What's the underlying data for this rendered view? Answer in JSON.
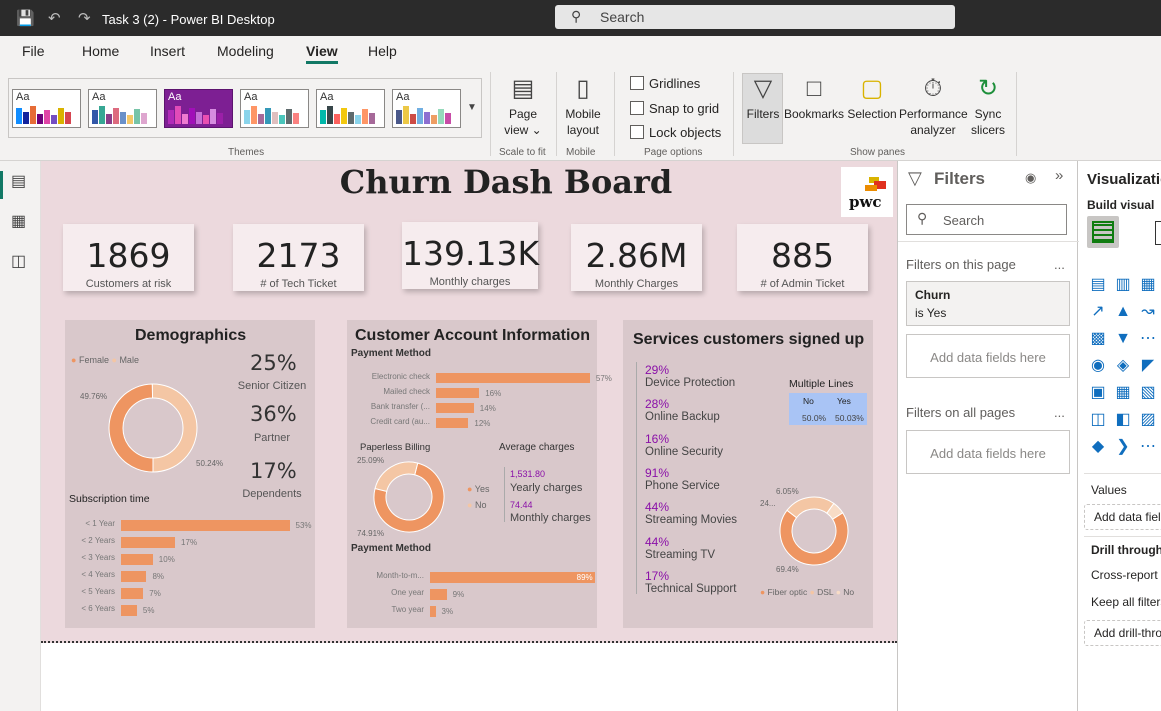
{
  "app": {
    "title": "Task 3 (2) - Power BI Desktop"
  },
  "titlebar": {
    "search_placeholder": "Search"
  },
  "menu": {
    "items": [
      "File",
      "Home",
      "Insert",
      "Modeling",
      "View",
      "Help"
    ],
    "active": "View"
  },
  "ribbon": {
    "themes_label": "Themes",
    "theme_badge": "Aa",
    "page_view": {
      "line1": "Page",
      "line2": "view",
      "group": "Scale to fit"
    },
    "mobile": {
      "line1": "Mobile",
      "line2": "layout",
      "group": "Mobile"
    },
    "page_options": {
      "gridlines": "Gridlines",
      "snap": "Snap to grid",
      "lock": "Lock objects",
      "group": "Page options"
    },
    "show_panes": {
      "filters": "Filters",
      "bookmarks": "Bookmarks",
      "selection": "Selection",
      "performance": "Performance",
      "analyzer": "analyzer",
      "sync": "Sync",
      "slicers": "slicers",
      "group": "Show panes"
    }
  },
  "report": {
    "title": "Churn Dash Board",
    "logo_text": "pwc",
    "kpis": [
      {
        "value": "1869",
        "label": "Customers at risk"
      },
      {
        "value": "2173",
        "label": "# of Tech Ticket"
      },
      {
        "value": "139.13K",
        "label": "Monthly charges"
      },
      {
        "value": "2.86M",
        "label": "Monthly Charges"
      },
      {
        "value": "885",
        "label": "# of Admin Ticket"
      }
    ],
    "demographics": {
      "title": "Demographics",
      "legend": [
        "Female",
        "Male"
      ],
      "donut_labels": [
        "49.76%",
        "50.24%"
      ],
      "stats": [
        {
          "value": "25%",
          "label": "Senior Citizen"
        },
        {
          "value": "36%",
          "label": "Partner"
        },
        {
          "value": "17%",
          "label": "Dependents"
        }
      ],
      "subscription_title": "Subscription time"
    },
    "account": {
      "title": "Customer Account Information",
      "payment_title": "Payment Method",
      "paperless_title": "Paperless Billing",
      "paperless_labels": [
        "25.09%",
        "74.91%"
      ],
      "paperless_legend": [
        "Yes",
        "No"
      ],
      "avg_title": "Average charges",
      "avg_yearly_value": "1,531.80",
      "avg_yearly_label": "Yearly charges",
      "avg_monthly_value": "74.44",
      "avg_monthly_label": "Monthly charges",
      "contract_title": "Payment Method"
    },
    "services": {
      "title": "Services customers signed up",
      "items": [
        {
          "pct": "29%",
          "label": "Device Protection"
        },
        {
          "pct": "28%",
          "label": "Online Backup"
        },
        {
          "pct": "16%",
          "label": "Online Security"
        },
        {
          "pct": "91%",
          "label": "Phone Service"
        },
        {
          "pct": "44%",
          "label": "Streaming Movies"
        },
        {
          "pct": "44%",
          "label": "Streaming TV"
        },
        {
          "pct": "17%",
          "label": "Technical Support"
        }
      ],
      "multiple_lines": {
        "title": "Multiple Lines",
        "headers": [
          "No",
          "Yes"
        ],
        "values": [
          "50.0%",
          "50.03%"
        ]
      },
      "internet_labels": [
        "6.05%",
        "24...",
        "69.4%"
      ],
      "internet_legend": [
        "Fiber optic",
        "DSL",
        "No"
      ]
    }
  },
  "chart_data": [
    {
      "type": "pie",
      "title": "",
      "categories": [
        "Female",
        "Male"
      ],
      "values": [
        49.76,
        50.24
      ]
    },
    {
      "type": "bar",
      "title": "Subscription time",
      "categories": [
        "< 1 Year",
        "< 2 Years",
        "< 3 Years",
        "< 4 Years",
        "< 5 Years",
        "< 6 Years"
      ],
      "values": [
        53,
        17,
        10,
        8,
        7,
        5
      ],
      "xlim": [
        0,
        100
      ]
    },
    {
      "type": "bar",
      "title": "Payment Method",
      "categories": [
        "Electronic check",
        "Mailed check",
        "Bank transfer (...",
        "Credit card (au..."
      ],
      "values": [
        57,
        16,
        14,
        12
      ],
      "xlim": [
        0,
        100
      ]
    },
    {
      "type": "pie",
      "title": "Paperless Billing",
      "categories": [
        "Yes",
        "No"
      ],
      "values": [
        74.91,
        25.09
      ]
    },
    {
      "type": "bar",
      "title": "Payment Method",
      "categories": [
        "Month-to-m...",
        "One year",
        "Two year"
      ],
      "values": [
        89,
        9,
        3
      ],
      "xlim": [
        0,
        100
      ]
    },
    {
      "type": "pie",
      "title": "",
      "categories": [
        "Fiber optic",
        "DSL",
        "No"
      ],
      "values": [
        69.4,
        24.55,
        6.05
      ]
    }
  ],
  "filters_pane": {
    "title": "Filters",
    "search_placeholder": "Search",
    "on_this_page": "Filters on this page",
    "churn_field": "Churn",
    "churn_value": "is Yes",
    "add_fields": "Add data fields here",
    "on_all_pages": "Filters on all pages",
    "dots": "..."
  },
  "viz_pane": {
    "title": "Visualizations",
    "build_visual": "Build visual",
    "values_label": "Values",
    "add_data_field": "Add data fields here",
    "drill_through": "Drill through",
    "cross_report": "Cross-report",
    "keep_all_filters": "Keep all filters",
    "add_drill": "Add drill-through fields here"
  },
  "colors": {
    "accent": "#117865",
    "canvas": "#ecd9dd",
    "panel": "#d9c8cb",
    "bar": "#ee9561",
    "bar_light": "#f4c6a4",
    "purple": "#8a10a8"
  }
}
